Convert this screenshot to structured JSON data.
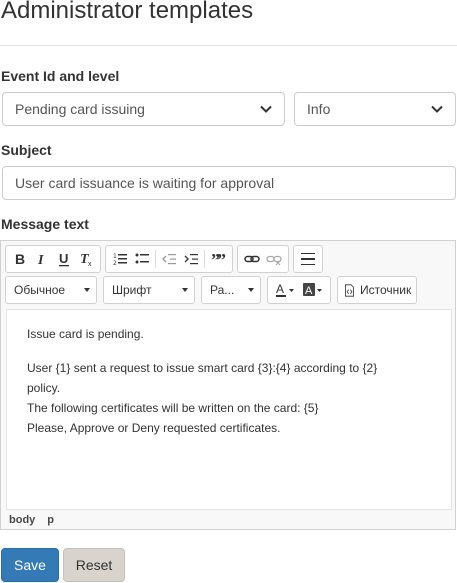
{
  "page": {
    "title": "Administrator templates"
  },
  "event": {
    "label": "Event Id and level",
    "event_value": "Pending card issuing",
    "level_value": "Info"
  },
  "subject": {
    "label": "Subject",
    "value": "User card issuance is waiting for approval"
  },
  "message": {
    "label": "Message text",
    "toolbar": {
      "format_label": "Обычное",
      "font_label": "Шрифт",
      "size_label": "Ра...",
      "source_label": "Источник",
      "icons": [
        "bold-icon",
        "italic-icon",
        "underline-icon",
        "remove-format-icon",
        "numbered-list-icon",
        "bulleted-list-icon",
        "outdent-icon",
        "indent-icon",
        "blockquote-icon",
        "link-icon",
        "unlink-icon",
        "horizontal-rule-icon",
        "text-color-icon",
        "background-color-icon",
        "source-icon"
      ]
    },
    "body": {
      "p1": "Issue card is pending.",
      "p2_l1": "User {1} sent a request to issue smart card {3}:{4} according to {2}",
      "p2_l2": "policy.",
      "p2_l3": "The following certificates will be written on the card: {5}",
      "p2_l4": "Please, Approve or Deny requested certificates."
    },
    "path": [
      "body",
      "p"
    ]
  },
  "actions": {
    "save_label": "Save",
    "reset_label": "Reset"
  },
  "colors": {
    "primary": "#337ab7",
    "reset_bg": "#d8d3cd"
  }
}
